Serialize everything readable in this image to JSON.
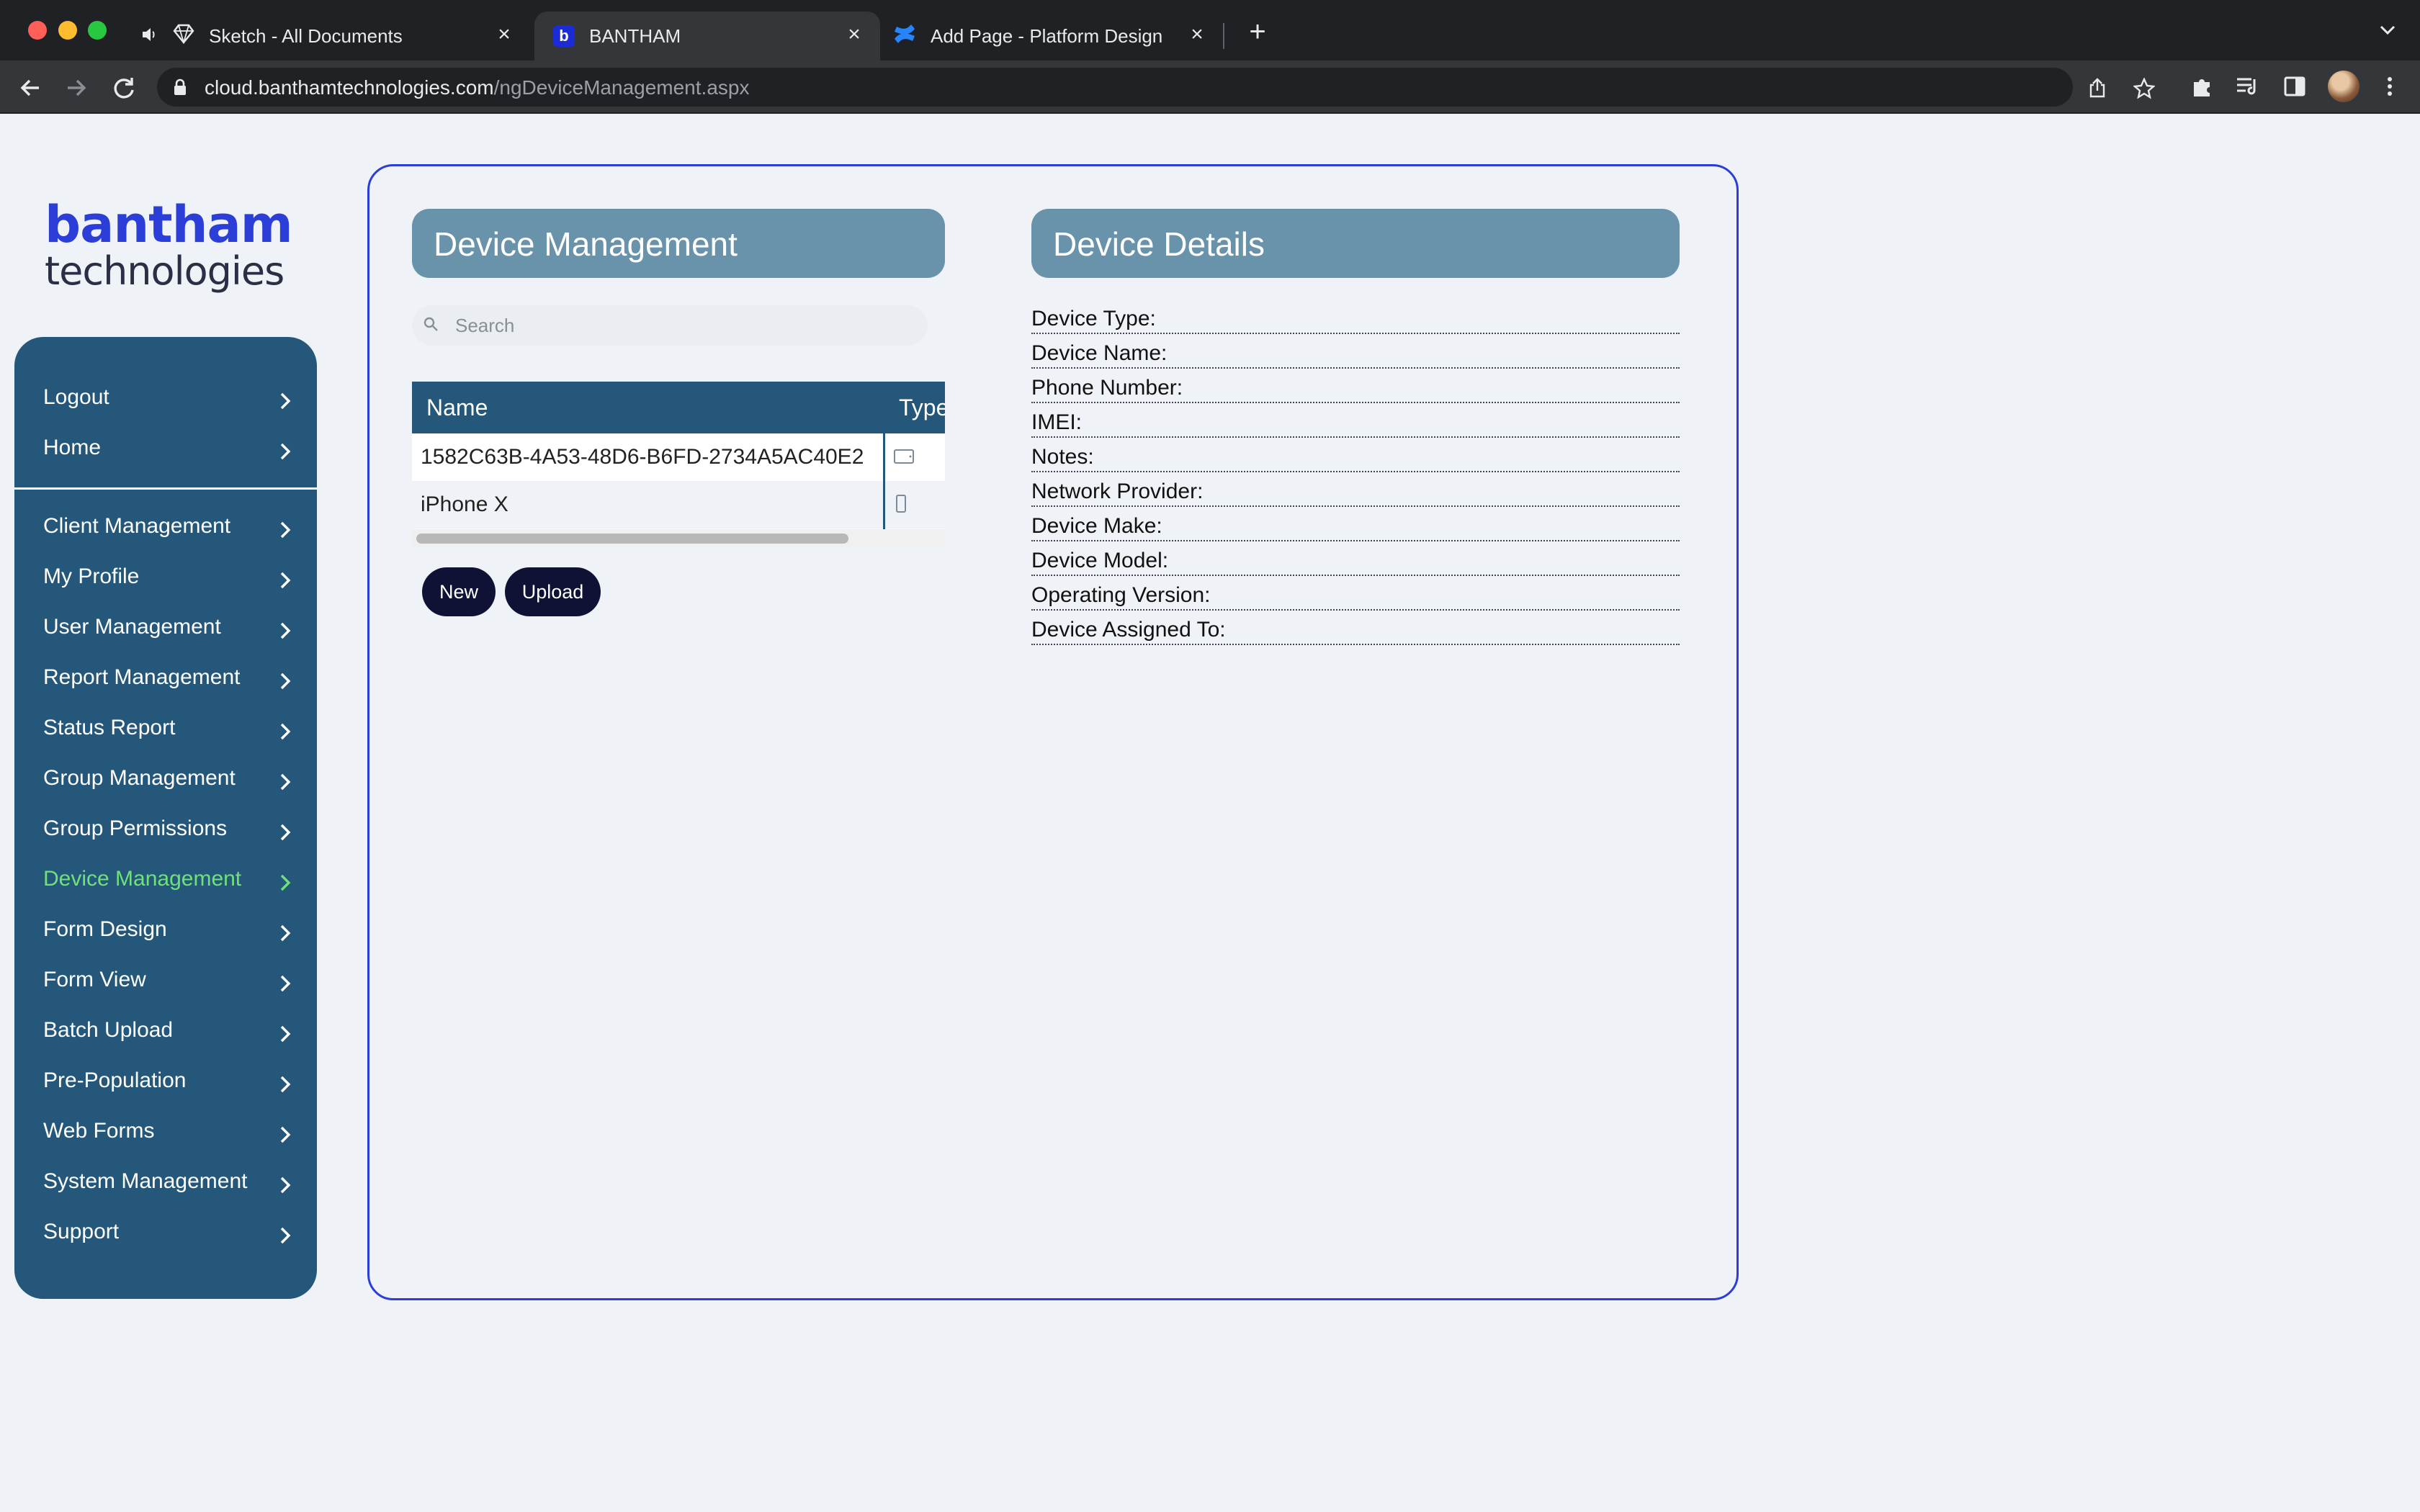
{
  "browser": {
    "tabs": [
      {
        "title": "Sketch - All Documents",
        "icon": "sketch-diamond-icon",
        "audio": true
      },
      {
        "title": "BANTHAM",
        "icon": "bantham-favicon",
        "favicon_letter": "b"
      },
      {
        "title": "Add Page - Platform Design - J",
        "icon": "confluence-icon"
      }
    ],
    "url_host": "cloud.banthamtechnologies.com",
    "url_path": "/ngDeviceManagement.aspx"
  },
  "logo": {
    "line1": "bantham",
    "line2": "technologies",
    "color": "#2b3fd8"
  },
  "sidebar": {
    "top_items": [
      {
        "label": "Logout"
      },
      {
        "label": "Home"
      }
    ],
    "items": [
      {
        "label": "Client Management"
      },
      {
        "label": "My Profile"
      },
      {
        "label": "User Management"
      },
      {
        "label": "Report Management"
      },
      {
        "label": "Status Report"
      },
      {
        "label": "Group Management"
      },
      {
        "label": "Group Permissions"
      },
      {
        "label": "Device Management",
        "active": true
      },
      {
        "label": "Form Design"
      },
      {
        "label": "Form View"
      },
      {
        "label": "Batch Upload"
      },
      {
        "label": "Pre-Population"
      },
      {
        "label": "Web Forms"
      },
      {
        "label": "System Management"
      },
      {
        "label": "Support"
      }
    ],
    "active_color": "#6fe07a",
    "bg_color": "#245779"
  },
  "device_management": {
    "title": "Device Management",
    "search_placeholder": "Search",
    "columns": [
      "Name",
      "Type"
    ],
    "rows": [
      {
        "name": "1582C63B-4A53-48D6-B6FD-2734A5AC40E2",
        "type_icon": "tablet-icon"
      },
      {
        "name": "iPhone X",
        "type_icon": "phone-icon"
      }
    ],
    "buttons": {
      "new": "New",
      "upload": "Upload"
    }
  },
  "device_details": {
    "title": "Device Details",
    "fields": [
      "Device Type:",
      "Device Name:",
      "Phone Number:",
      "IMEI:",
      "Notes:",
      "Network Provider:",
      "Device Make:",
      "Device Model:",
      "Operating Version:",
      "Device Assigned To:"
    ]
  }
}
